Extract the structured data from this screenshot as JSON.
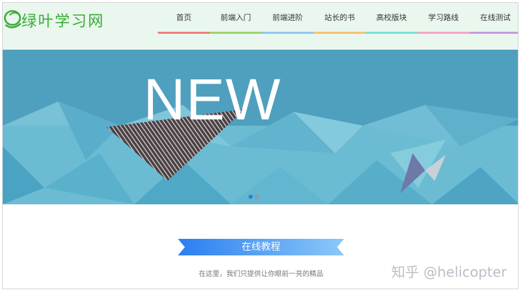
{
  "logo": {
    "text": "绿叶学习网",
    "icon": "leaf-logo-icon"
  },
  "nav": {
    "items": [
      {
        "label": "首页",
        "color": "#f08080"
      },
      {
        "label": "前端入门",
        "color": "#9fd36f"
      },
      {
        "label": "前端进阶",
        "color": "#8fc7ef"
      },
      {
        "label": "站长的书",
        "color": "#f5c274"
      },
      {
        "label": "高校版块",
        "color": "#79e0d9"
      },
      {
        "label": "学习路线",
        "color": "#f4a5c4"
      },
      {
        "label": "在线测试",
        "color": "#c79be0"
      }
    ]
  },
  "banner": {
    "headline": "NEW",
    "dot_count": 2,
    "active_dot": 0,
    "colors": {
      "sky": "#4f9fbe",
      "crystal": "#6bbcd3",
      "stripe": "#4a4145"
    }
  },
  "section": {
    "title": "在线教程",
    "subtitle": "在这里，我们只提供让你眼前一亮的精品",
    "ribbon_color": "#3b8ef2"
  },
  "watermark": "知乎 @helicopter"
}
